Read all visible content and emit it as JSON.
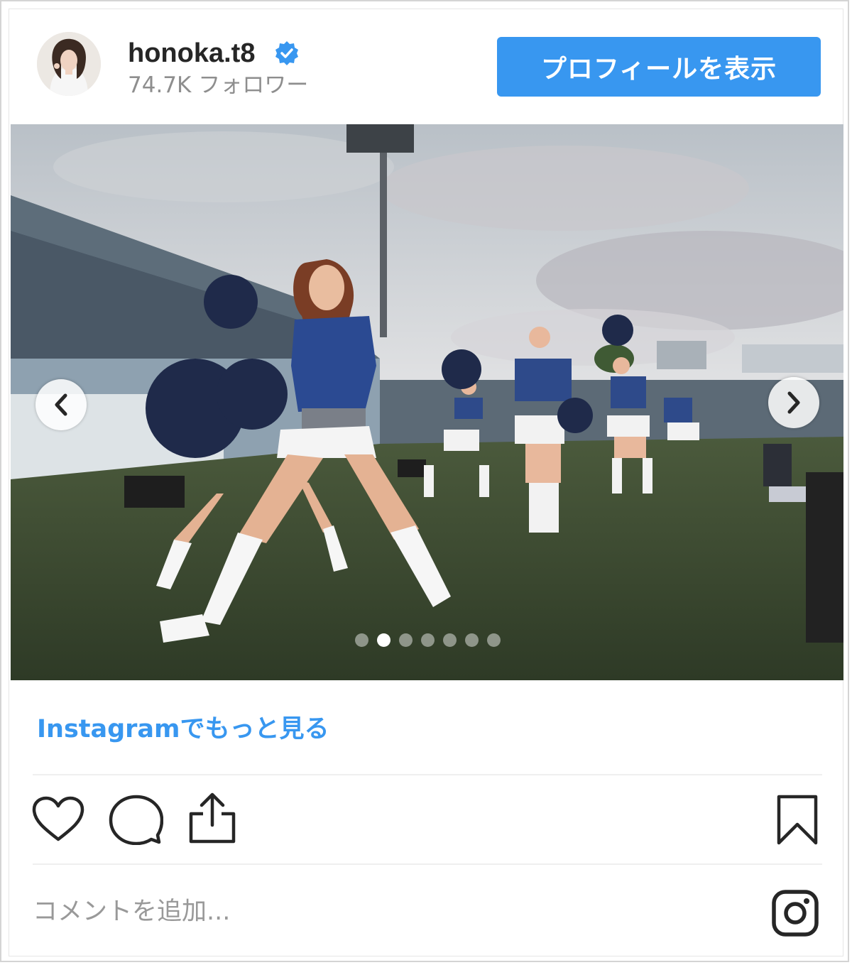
{
  "header": {
    "username": "honoka.t8",
    "followers": "74.7K フォロワー",
    "profile_button": "プロフィールを表示"
  },
  "carousel": {
    "slide_count": 7,
    "active_index": 1
  },
  "more_link": "Instagramでもっと見る",
  "comment": {
    "placeholder": "コメントを追加..."
  },
  "icons": {
    "like": "heart-icon",
    "comment": "comment-icon",
    "share": "share-icon",
    "save": "bookmark-icon",
    "logo": "instagram-logo-icon"
  },
  "colors": {
    "accent": "#3897f0",
    "verified": "#3897f0",
    "text": "#262626",
    "muted": "#8e8e8e"
  }
}
